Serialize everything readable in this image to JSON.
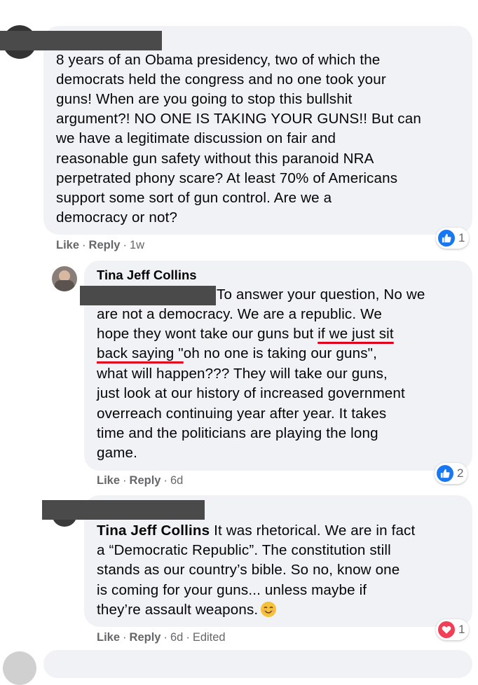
{
  "comments": [
    {
      "author": "",
      "lines": [
        "8 years of an Obama presidency, two of which the",
        "democrats held the congress and no one took your",
        "guns! When are you going to stop this bullshit",
        "argument?! NO ONE IS TAKING YOUR GUNS!! But can",
        "we have a legitimate discussion on fair and",
        "reasonable gun safety without this paranoid NRA",
        "perpetrated phony scare? At least 70% of Americans",
        "support some sort of gun control. Are we a",
        "democracy or not?"
      ],
      "like": "Like",
      "reply": "Reply",
      "time": "1w",
      "reaction": {
        "type": "like",
        "count": "1",
        "color": "#1877f2"
      }
    },
    {
      "author": "Tina Jeff Collins",
      "text_parts": {
        "l1": "To answer your question, No we",
        "l2": "are not a democracy. We are a republic. We",
        "l3a": "hope they wont take our guns but ",
        "l3b": "if we just sit",
        "l4a": "back saying \"",
        "l4b": "oh no one is taking our guns\",",
        "l5": "what will happen??? They will take our guns,",
        "l6": "just look at our history of increased government",
        "l7": "overreach continuing year after year. It takes",
        "l8": "time and the politicians are playing the long",
        "l9": "game."
      },
      "like": "Like",
      "reply": "Reply",
      "time": "6d",
      "reaction": {
        "type": "like",
        "count": "2",
        "color": "#1877f2"
      }
    },
    {
      "author": "",
      "mention": "Tina Jeff Collins",
      "text_parts": {
        "l1": " It was rhetorical. We are in fact",
        "l2": "a “Democratic Republic”. The constitution still",
        "l3": "stands as our country’s bible. So no, know one",
        "l4": "is coming for your guns... unless maybe if",
        "l5": "they’re assault weapons."
      },
      "like": "Like",
      "reply": "Reply",
      "time": "6d",
      "edited": "Edited",
      "reaction": {
        "type": "love",
        "count": "1",
        "color": "#f33e58"
      }
    }
  ],
  "colors": {
    "bubble": "#f0f2f5",
    "meta": "#65676b",
    "underline": "#e3001b"
  }
}
